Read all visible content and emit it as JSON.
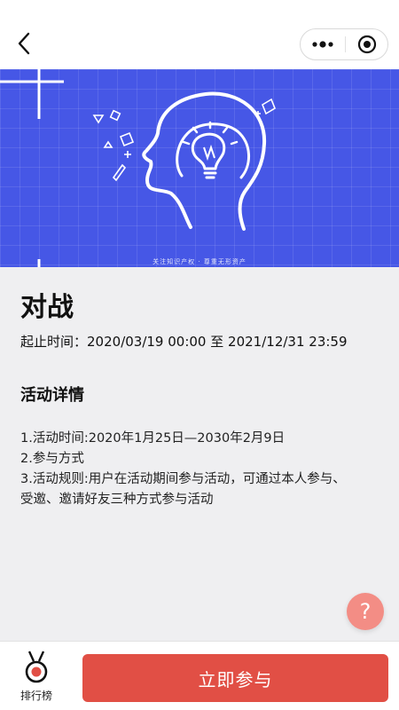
{
  "nav": {
    "back_icon": "chevron-left-icon",
    "more_icon": "more-dots-icon",
    "close_icon": "target-close-icon"
  },
  "banner": {
    "caption": "关注知识产权 · 尊重无形资产",
    "colors": {
      "background": "#4657e6",
      "line": "#ffffff"
    }
  },
  "activity": {
    "title": "对战",
    "period_label": "起止时间：",
    "start": "2020/03/19 00:00",
    "to": "至",
    "end": "2021/12/31 23:59"
  },
  "details": {
    "heading": "活动详情",
    "lines": [
      "1.活动时间:2020年1月25日—2030年2月9日",
      "2.参与方式",
      "3.活动规则:用户在活动期间参与活动，可通过本人参与、受邀、邀请好友三种方式参与活动"
    ]
  },
  "help": {
    "icon_text": "?",
    "color": "#f38d85"
  },
  "bottom": {
    "rank_label": "排行榜",
    "rank_icon": "medal-icon",
    "join_label": "立即参与",
    "join_color": "#e14f45"
  }
}
